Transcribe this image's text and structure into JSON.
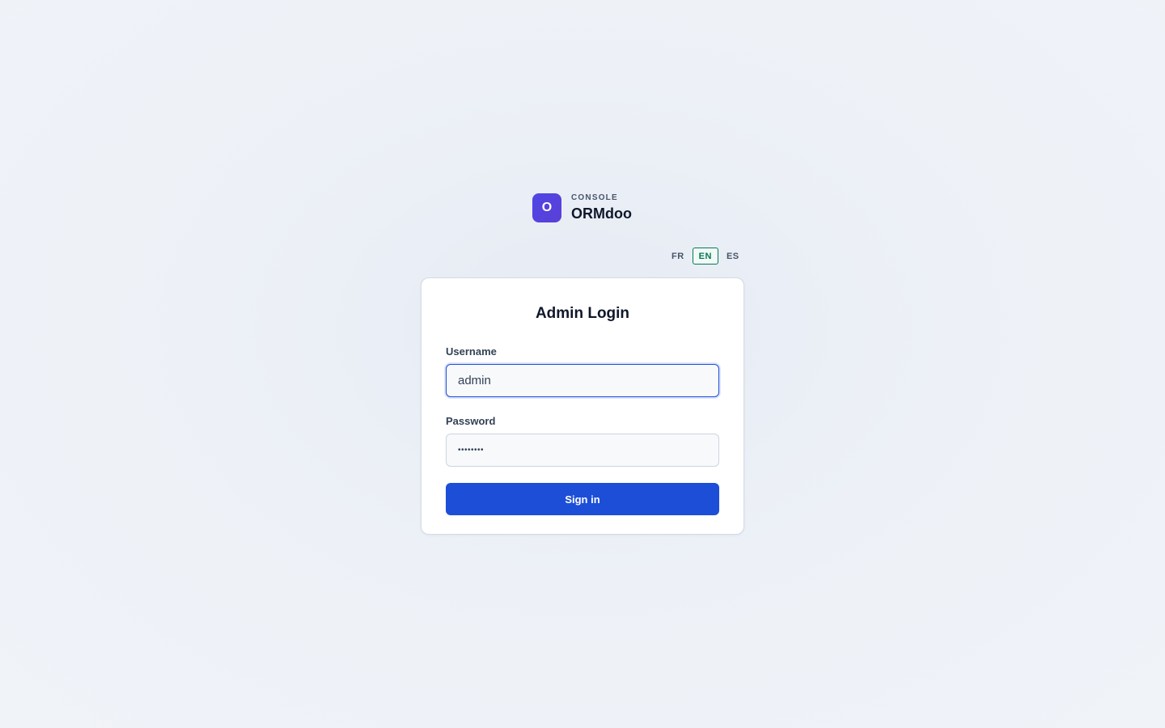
{
  "brand": {
    "logo_letter": "O",
    "subtitle": "CONSOLE",
    "name": "ORMdoo",
    "logo_color": "#4f46e5"
  },
  "language": {
    "options": [
      "FR",
      "EN",
      "ES"
    ],
    "selected": "EN",
    "active_color": "#047857"
  },
  "login": {
    "title": "Admin Login",
    "username_label": "Username",
    "username_value": "admin",
    "password_label": "Password",
    "password_value": "••••••••",
    "submit_label": "Sign in",
    "accent_color": "#1d4ed8"
  }
}
